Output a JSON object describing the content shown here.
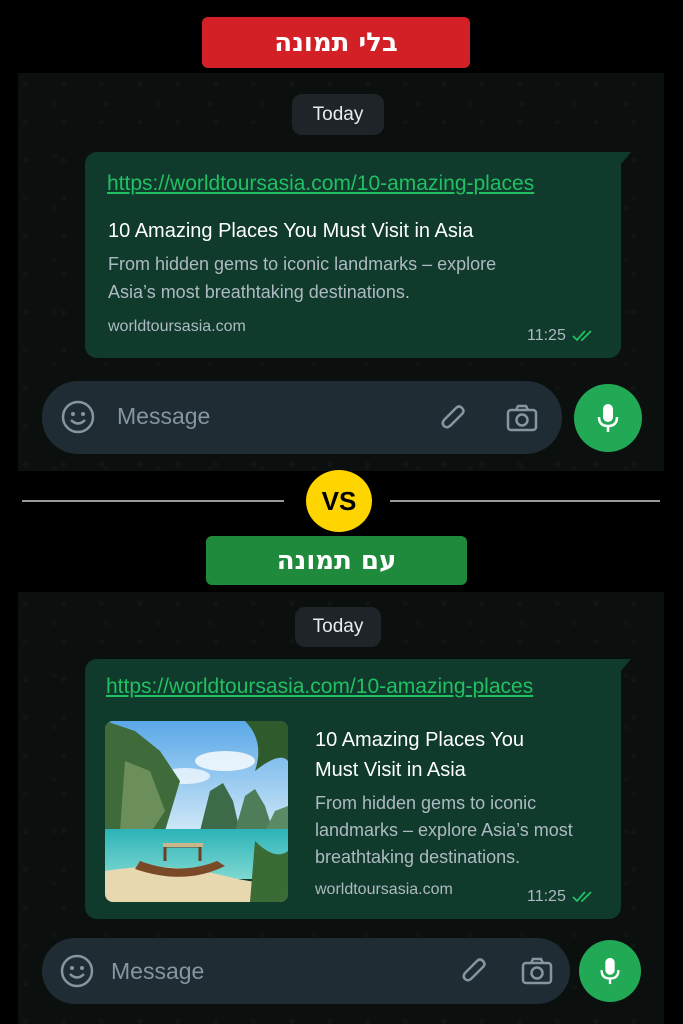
{
  "labels": {
    "top": "בלי תמונה",
    "bottom": "עם תמונה",
    "vs": "VS"
  },
  "chat_top": {
    "date": "Today",
    "message": {
      "url": "https://worldtoursasia.com/10-amazing-places",
      "title": "10 Amazing Places You Must Visit in Asia",
      "description_line1": "From hidden gems to iconic landmarks – explore",
      "description_line2": "Asia’s most breathtaking destinations.",
      "domain": "worldtoursasia.com",
      "time": "11:25"
    },
    "input": {
      "placeholder": "Message"
    }
  },
  "chat_bottom": {
    "date": "Today",
    "message": {
      "url": "https://worldtoursasia.com/10-amazing-places",
      "title_line1": "10 Amazing Places You",
      "title_line2": "Must Visit in Asia",
      "description_line1": "From hidden gems to iconic",
      "description_line2": "landmarks – explore Asia’s most",
      "description_line3": "breathtaking destinations.",
      "domain": "worldtoursasia.com",
      "time": "11:25"
    },
    "input": {
      "placeholder": "Message"
    }
  },
  "icons": [
    "emoji-icon",
    "attachment-icon",
    "camera-icon",
    "microphone-icon",
    "read-receipt-icon"
  ],
  "colors": {
    "bubble": "#0f3a2c",
    "link": "#21c063",
    "accent": "#21a956",
    "no_image_tag": "#d32027",
    "with_image_tag": "#1f8a3b",
    "vs": "#ffd500"
  }
}
